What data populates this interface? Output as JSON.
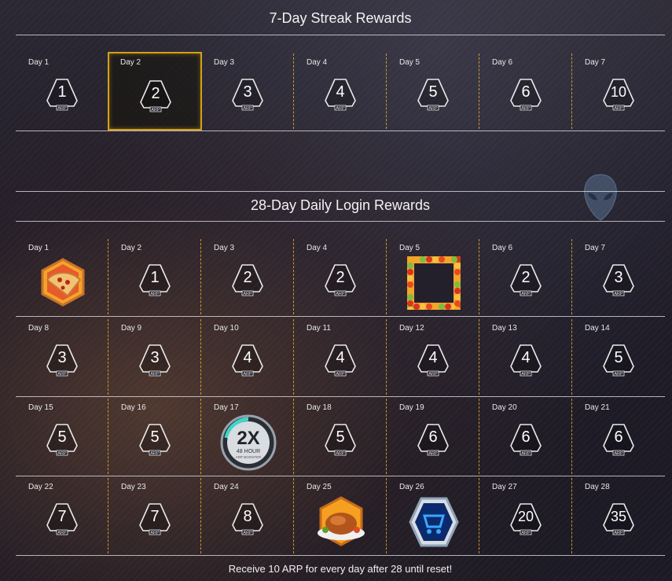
{
  "streak": {
    "title": "7-Day Streak Rewards",
    "days": [
      {
        "label": "Day 1",
        "value": "1",
        "currency": "ARP"
      },
      {
        "label": "Day 2",
        "value": "2",
        "currency": "ARP"
      },
      {
        "label": "Day 3",
        "value": "3",
        "currency": "ARP"
      },
      {
        "label": "Day 4",
        "value": "4",
        "currency": "ARP"
      },
      {
        "label": "Day 5",
        "value": "5",
        "currency": "ARP"
      },
      {
        "label": "Day 6",
        "value": "6",
        "currency": "ARP"
      },
      {
        "label": "Day 7",
        "value": "10",
        "currency": "ARP"
      }
    ],
    "highlighted_day": 2
  },
  "daily": {
    "title": "28-Day Daily Login Rewards",
    "days": [
      {
        "label": "Day 1",
        "type": "pizza-icon"
      },
      {
        "label": "Day 2",
        "value": "1",
        "currency": "ARP"
      },
      {
        "label": "Day 3",
        "value": "2",
        "currency": "ARP"
      },
      {
        "label": "Day 4",
        "value": "2",
        "currency": "ARP"
      },
      {
        "label": "Day 5",
        "type": "autumn-leaves-frame-icon"
      },
      {
        "label": "Day 6",
        "value": "2",
        "currency": "ARP"
      },
      {
        "label": "Day 7",
        "value": "3",
        "currency": "ARP"
      },
      {
        "label": "Day 8",
        "value": "3",
        "currency": "ARP"
      },
      {
        "label": "Day 9",
        "value": "3",
        "currency": "ARP"
      },
      {
        "label": "Day 10",
        "value": "4",
        "currency": "ARP"
      },
      {
        "label": "Day 11",
        "value": "4",
        "currency": "ARP"
      },
      {
        "label": "Day 12",
        "value": "4",
        "currency": "ARP"
      },
      {
        "label": "Day 13",
        "value": "4",
        "currency": "ARP"
      },
      {
        "label": "Day 14",
        "value": "5",
        "currency": "ARP"
      },
      {
        "label": "Day 15",
        "value": "5",
        "currency": "ARP"
      },
      {
        "label": "Day 16",
        "value": "5",
        "currency": "ARP"
      },
      {
        "label": "Day 17",
        "type": "boost-2x-icon",
        "boost": {
          "mult": "2X",
          "line1": "48 HOUR",
          "line2": "ARP",
          "line3": "BOOSTER"
        }
      },
      {
        "label": "Day 18",
        "value": "5",
        "currency": "ARP"
      },
      {
        "label": "Day 19",
        "value": "6",
        "currency": "ARP"
      },
      {
        "label": "Day 20",
        "value": "6",
        "currency": "ARP"
      },
      {
        "label": "Day 21",
        "value": "6",
        "currency": "ARP"
      },
      {
        "label": "Day 22",
        "value": "7",
        "currency": "ARP"
      },
      {
        "label": "Day 23",
        "value": "7",
        "currency": "ARP"
      },
      {
        "label": "Day 24",
        "value": "8",
        "currency": "ARP"
      },
      {
        "label": "Day 25",
        "type": "turkey-icon"
      },
      {
        "label": "Day 26",
        "type": "shopping-cart-badge-icon"
      },
      {
        "label": "Day 27",
        "value": "20",
        "currency": "ARP"
      },
      {
        "label": "Day 28",
        "value": "35",
        "currency": "ARP"
      }
    ]
  },
  "footer": "Receive 10 ARP for every day after 28 until reset!",
  "colors": {
    "accent": "#d4a017",
    "divider": "#e6aa28",
    "text": "#ffffff"
  }
}
